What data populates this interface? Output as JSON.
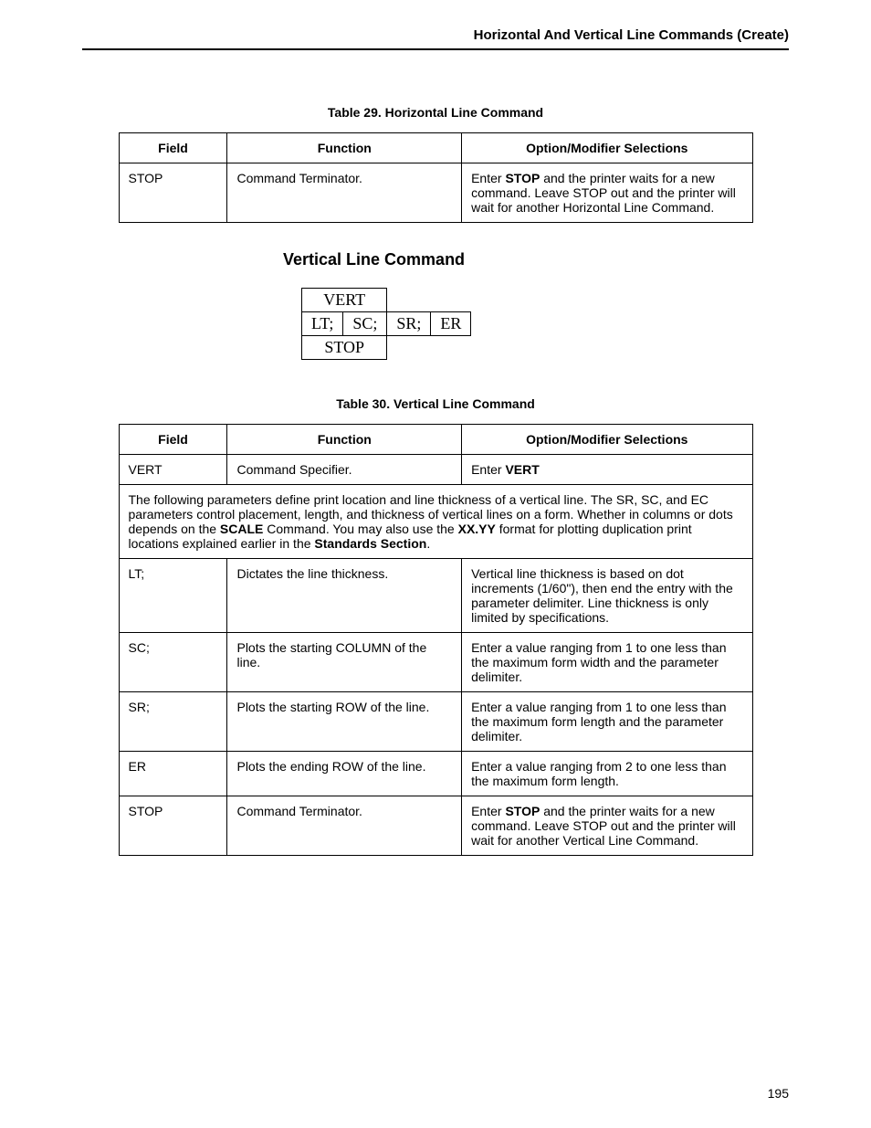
{
  "header": {
    "title": "Horizontal And Vertical Line Commands (Create)"
  },
  "table29": {
    "caption": "Table 29. Horizontal Line Command",
    "headers": {
      "field": "Field",
      "function": "Function",
      "options": "Option/Modifier Selections"
    },
    "rows": [
      {
        "field": "STOP",
        "function": "Command Terminator.",
        "options_pre": "Enter ",
        "options_bold": "STOP",
        "options_post": " and the printer waits for a new command. Leave STOP out and the printer will wait for another Horizontal Line Command."
      }
    ]
  },
  "section_title": "Vertical Line Command",
  "syntax": {
    "row1": "VERT",
    "row2": [
      "LT;",
      "SC;",
      "SR;",
      "ER"
    ],
    "row3": "STOP"
  },
  "table30": {
    "caption": "Table 30. Vertical Line Command",
    "headers": {
      "field": "Field",
      "function": "Function",
      "options": "Option/Modifier Selections"
    },
    "row_vert": {
      "field": "VERT",
      "function": "Command Specifier.",
      "options_pre": "Enter ",
      "options_bold": "VERT",
      "options_post": ""
    },
    "note": {
      "pre": "The following parameters define print location and line thickness of a vertical line. The SR, SC, and EC parameters control placement, length, and thickness of vertical lines on a form. Whether in columns or dots depends on the ",
      "b1": "SCALE",
      "mid1": " Command. You may also use the ",
      "b2": "XX.YY",
      "mid2": " format for plotting duplication print locations explained earlier in the ",
      "b3": "Standards Section",
      "post": "."
    },
    "row_lt": {
      "field": "LT;",
      "function": "Dictates the line thickness.",
      "options": "Vertical line thickness is based on dot increments (1/60\"), then end the entry with the parameter delimiter. Line thickness is only limited by specifications."
    },
    "row_sc": {
      "field": "SC;",
      "function": "Plots the starting COLUMN of the line.",
      "options": "Enter a value ranging from 1 to one less than the maximum form width and the parameter delimiter."
    },
    "row_sr": {
      "field": "SR;",
      "function": "Plots the starting ROW of the line.",
      "options": "Enter a value ranging from 1 to one less than the maximum form length and the parameter delimiter."
    },
    "row_er": {
      "field": "ER",
      "function": "Plots the ending ROW of the line.",
      "options": "Enter a value ranging from 2 to one less than the maximum form length."
    },
    "row_stop": {
      "field": "STOP",
      "function": "Command Terminator.",
      "options_pre": "Enter ",
      "options_bold": "STOP",
      "options_post": " and the printer waits for a new command. Leave STOP out and the printer will wait for another Vertical Line Command."
    }
  },
  "page_number": "195"
}
